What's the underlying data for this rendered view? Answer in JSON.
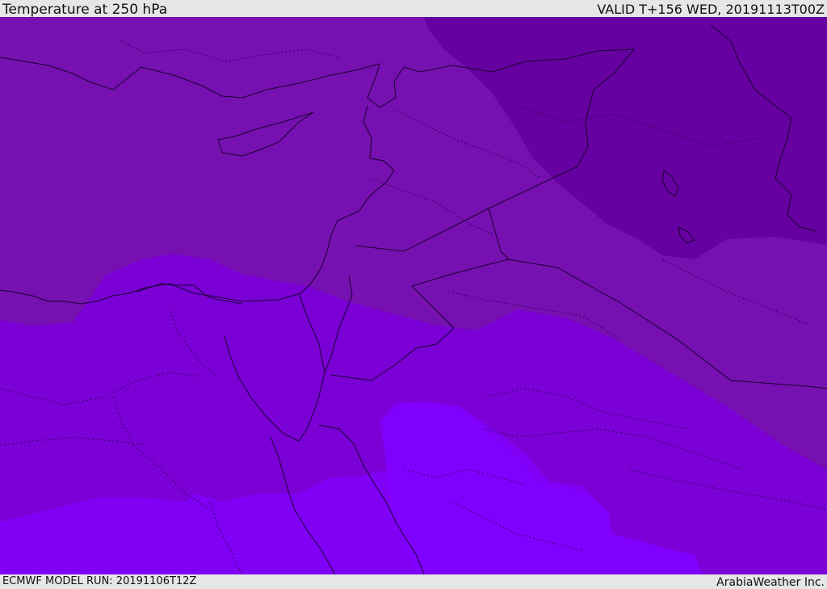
{
  "header": {
    "title": "Temperature at 250 hPa",
    "valid": "VALID T+156 WED, 20191113T00Z"
  },
  "footer": {
    "model_run": "ECMWF MODEL RUN: 20191106T12Z",
    "brand": "ArabiaWeather Inc."
  },
  "map": {
    "field": "temperature",
    "level": "250 hPa",
    "colors": {
      "darkest": "#6600a0",
      "dark": "#7610b0",
      "mid": "#7b00d6",
      "light": "#7f00f5",
      "lightest": "#8000ff",
      "borders": "#1a0033"
    }
  }
}
